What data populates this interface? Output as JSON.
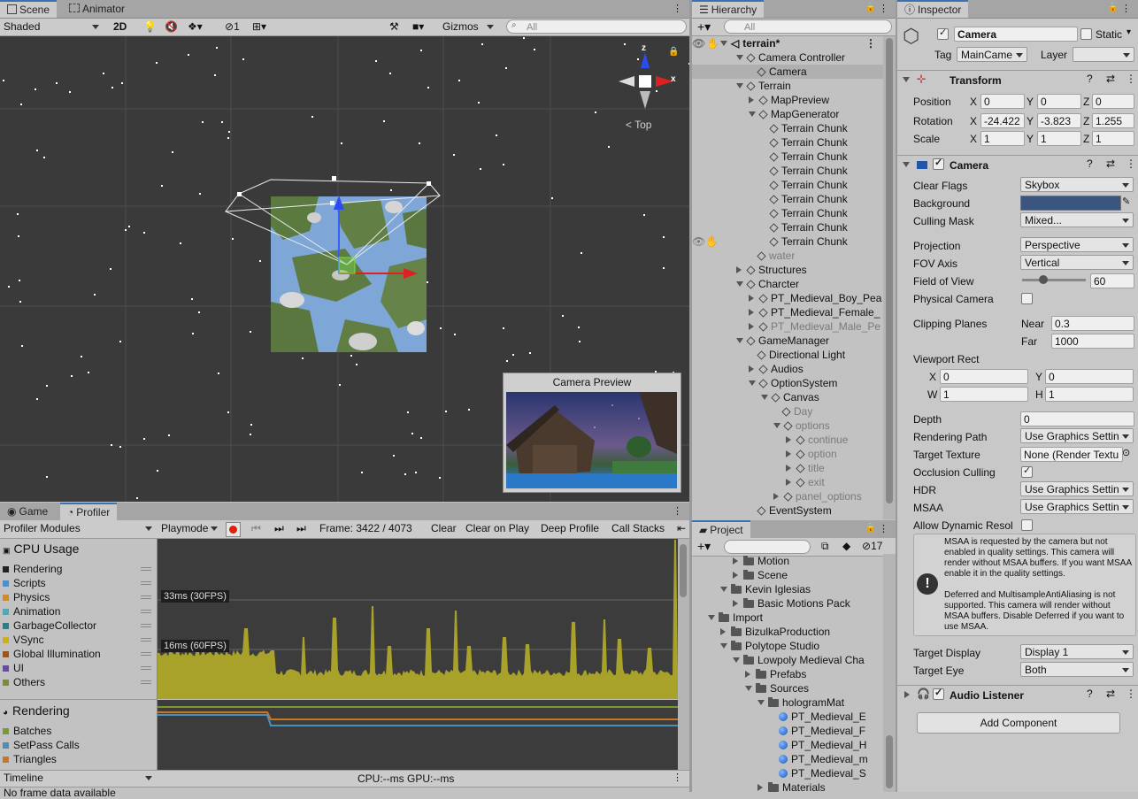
{
  "scene": {
    "tabs": [
      "Scene",
      "Animator"
    ],
    "shading": "Shaded",
    "mode2d": "2D",
    "hidden_count": "1",
    "gizmos": "Gizmos",
    "search_placeholder": "All",
    "view_label": "Top",
    "axis_x": "x",
    "axis_z": "z",
    "camera_preview_title": "Camera Preview"
  },
  "hierarchy": {
    "tab": "Hierarchy",
    "search_placeholder": "All",
    "root": "terrain*",
    "items": [
      {
        "label": "Camera Controller",
        "indent": 1,
        "arrow": "down",
        "icon": "cube",
        "dim": false
      },
      {
        "label": "Camera",
        "indent": 2,
        "arrow": "none",
        "icon": "cube",
        "dim": false,
        "selected": true
      },
      {
        "label": "Terrain",
        "indent": 1,
        "arrow": "down",
        "icon": "cube",
        "dim": false
      },
      {
        "label": "MapPreview",
        "indent": 2,
        "arrow": "right",
        "icon": "cube",
        "dim": false
      },
      {
        "label": "MapGenerator",
        "indent": 2,
        "arrow": "down",
        "icon": "cube",
        "dim": false
      },
      {
        "label": "Terrain Chunk",
        "indent": 3,
        "arrow": "none",
        "icon": "cube",
        "dim": false
      },
      {
        "label": "Terrain Chunk",
        "indent": 3,
        "arrow": "none",
        "icon": "cube",
        "dim": false
      },
      {
        "label": "Terrain Chunk",
        "indent": 3,
        "arrow": "none",
        "icon": "cube",
        "dim": false
      },
      {
        "label": "Terrain Chunk",
        "indent": 3,
        "arrow": "none",
        "icon": "cube",
        "dim": false
      },
      {
        "label": "Terrain Chunk",
        "indent": 3,
        "arrow": "none",
        "icon": "cube",
        "dim": false
      },
      {
        "label": "Terrain Chunk",
        "indent": 3,
        "arrow": "none",
        "icon": "cube",
        "dim": false
      },
      {
        "label": "Terrain Chunk",
        "indent": 3,
        "arrow": "none",
        "icon": "cube",
        "dim": false
      },
      {
        "label": "Terrain Chunk",
        "indent": 3,
        "arrow": "none",
        "icon": "cube",
        "dim": false
      },
      {
        "label": "Terrain Chunk",
        "indent": 3,
        "arrow": "none",
        "icon": "cube",
        "dim": false
      },
      {
        "label": "water",
        "indent": 2,
        "arrow": "none",
        "icon": "cube",
        "dim": true
      },
      {
        "label": "Structures",
        "indent": 1,
        "arrow": "right",
        "icon": "cube",
        "dim": false
      },
      {
        "label": "Charcter",
        "indent": 1,
        "arrow": "down",
        "icon": "cube",
        "dim": false
      },
      {
        "label": "PT_Medieval_Boy_Pea",
        "indent": 2,
        "arrow": "right",
        "icon": "cube",
        "dim": false
      },
      {
        "label": "PT_Medieval_Female_",
        "indent": 2,
        "arrow": "right",
        "icon": "cube",
        "dim": false
      },
      {
        "label": "PT_Medieval_Male_Pe",
        "indent": 2,
        "arrow": "right",
        "icon": "cube",
        "dim": true
      },
      {
        "label": "GameManager",
        "indent": 1,
        "arrow": "down",
        "icon": "cube",
        "dim": false
      },
      {
        "label": "Directional Light",
        "indent": 2,
        "arrow": "none",
        "icon": "cube",
        "dim": false
      },
      {
        "label": "Audios",
        "indent": 2,
        "arrow": "right",
        "icon": "cube",
        "dim": false
      },
      {
        "label": "OptionSystem",
        "indent": 2,
        "arrow": "down",
        "icon": "cube",
        "dim": false
      },
      {
        "label": "Canvas",
        "indent": 3,
        "arrow": "down",
        "icon": "cube",
        "dim": false
      },
      {
        "label": "Day",
        "indent": 4,
        "arrow": "none",
        "icon": "cube",
        "dim": true
      },
      {
        "label": "options",
        "indent": 4,
        "arrow": "down",
        "icon": "cube",
        "dim": true
      },
      {
        "label": "continue",
        "indent": 5,
        "arrow": "right",
        "icon": "cube",
        "dim": true
      },
      {
        "label": "option",
        "indent": 5,
        "arrow": "right",
        "icon": "cube",
        "dim": true
      },
      {
        "label": "title",
        "indent": 5,
        "arrow": "right",
        "icon": "cube",
        "dim": true
      },
      {
        "label": "exit",
        "indent": 5,
        "arrow": "right",
        "icon": "cube",
        "dim": true
      },
      {
        "label": "panel_options",
        "indent": 4,
        "arrow": "right",
        "icon": "cube",
        "dim": true
      },
      {
        "label": "EventSystem",
        "indent": 2,
        "arrow": "none",
        "icon": "cube",
        "dim": false
      }
    ]
  },
  "project": {
    "tab": "Project",
    "hidden_count": "17",
    "items": [
      {
        "label": "Motion",
        "indent": 3,
        "arrow": "right",
        "icon": "folder"
      },
      {
        "label": "Scene",
        "indent": 3,
        "arrow": "right",
        "icon": "folder"
      },
      {
        "label": "Kevin Iglesias",
        "indent": 2,
        "arrow": "down",
        "icon": "folder"
      },
      {
        "label": "Basic Motions Pack",
        "indent": 3,
        "arrow": "right",
        "icon": "folder"
      },
      {
        "label": "Import",
        "indent": 1,
        "arrow": "down",
        "icon": "folder"
      },
      {
        "label": "BizulkaProduction",
        "indent": 2,
        "arrow": "right",
        "icon": "folder"
      },
      {
        "label": "Polytope Studio",
        "indent": 2,
        "arrow": "down",
        "icon": "folder"
      },
      {
        "label": "Lowpoly Medieval Cha",
        "indent": 3,
        "arrow": "down",
        "icon": "folder"
      },
      {
        "label": "Prefabs",
        "indent": 4,
        "arrow": "right",
        "icon": "folder"
      },
      {
        "label": "Sources",
        "indent": 4,
        "arrow": "down",
        "icon": "folder"
      },
      {
        "label": "hologramMat",
        "indent": 5,
        "arrow": "down",
        "icon": "folder"
      },
      {
        "label": "PT_Medieval_E",
        "indent": 6,
        "arrow": "none",
        "icon": "sphere"
      },
      {
        "label": "PT_Medieval_F",
        "indent": 6,
        "arrow": "none",
        "icon": "sphere"
      },
      {
        "label": "PT_Medieval_H",
        "indent": 6,
        "arrow": "none",
        "icon": "sphere"
      },
      {
        "label": "PT_Medieval_m",
        "indent": 6,
        "arrow": "none",
        "icon": "sphere"
      },
      {
        "label": "PT_Medieval_S",
        "indent": 6,
        "arrow": "none",
        "icon": "sphere"
      },
      {
        "label": "Materials",
        "indent": 5,
        "arrow": "right",
        "icon": "folder"
      }
    ]
  },
  "inspector": {
    "tab": "Inspector",
    "object_name": "Camera",
    "static_label": "Static",
    "tag_label": "Tag",
    "tag_value": "MainCame",
    "layer_label": "Layer",
    "layer_value": "",
    "transform": {
      "title": "Transform",
      "position_label": "Position",
      "rotation_label": "Rotation",
      "scale_label": "Scale",
      "position": [
        "0",
        "0",
        "0"
      ],
      "rotation": [
        "-24.422",
        "-3.823",
        "1.255"
      ],
      "scale": [
        "1",
        "1",
        "1"
      ]
    },
    "camera": {
      "title": "Camera",
      "clear_flags_label": "Clear Flags",
      "clear_flags": "Skybox",
      "background_label": "Background",
      "background_color": "#3a5580",
      "culling_mask_label": "Culling Mask",
      "culling_mask": "Mixed...",
      "projection_label": "Projection",
      "projection": "Perspective",
      "fov_axis_label": "FOV Axis",
      "fov_axis": "Vertical",
      "fov_label": "Field of View",
      "fov": "60",
      "fov_fraction": 0.33,
      "physical_label": "Physical Camera",
      "clipping_label": "Clipping Planes",
      "near_label": "Near",
      "near": "0.3",
      "far_label": "Far",
      "far": "1000",
      "viewport_label": "Viewport Rect",
      "vx": "0",
      "vy": "0",
      "vw": "1",
      "vh": "1",
      "depth_label": "Depth",
      "depth": "0",
      "render_path_label": "Rendering Path",
      "render_path": "Use Graphics Settin",
      "target_tex_label": "Target Texture",
      "target_tex": "None (Render Textu",
      "occlusion_label": "Occlusion Culling",
      "hdr_label": "HDR",
      "hdr": "Use Graphics Settin",
      "msaa_label": "MSAA",
      "msaa": "Use Graphics Settin",
      "dyn_res_label": "Allow Dynamic Resol",
      "help_1": "MSAA is requested by the camera but not enabled in quality settings. This camera will render without MSAA buffers. If you want MSAA enable it in the quality settings.",
      "help_2": "Deferred and MultisampleAntiAliasing is not supported. This camera will render without MSAA buffers. Disable Deferred if you want to use MSAA.",
      "target_display_label": "Target Display",
      "target_display": "Display 1",
      "target_eye_label": "Target Eye",
      "target_eye": "Both"
    },
    "audio_listener": "Audio Listener",
    "add_component": "Add Component"
  },
  "profiler": {
    "tabs": [
      "Game",
      "Profiler"
    ],
    "modules_label": "Profiler Modules",
    "playmode": "Playmode",
    "frame": "Frame: 3422 / 4073",
    "clear": "Clear",
    "clear_on_play": "Clear on Play",
    "deep_profile": "Deep Profile",
    "call_stacks": "Call Stacks",
    "cpu_title": "CPU Usage",
    "cpu_items": [
      {
        "label": "Rendering",
        "color": "#222222"
      },
      {
        "label": "Scripts",
        "color": "#4a8fd0"
      },
      {
        "label": "Physics",
        "color": "#d08a2a"
      },
      {
        "label": "Animation",
        "color": "#4fa8b8"
      },
      {
        "label": "GarbageCollector",
        "color": "#2f7d8a"
      },
      {
        "label": "VSync",
        "color": "#c8b020"
      },
      {
        "label": "Global Illumination",
        "color": "#a0541a"
      },
      {
        "label": "UI",
        "color": "#6a4aa0"
      },
      {
        "label": "Others",
        "color": "#7a8a40"
      }
    ],
    "rendering_title": "Rendering",
    "render_items": [
      {
        "label": "Batches",
        "color": "#7a9a30"
      },
      {
        "label": "SetPass Calls",
        "color": "#4a8fb8"
      },
      {
        "label": "Triangles",
        "color": "#c87820"
      }
    ],
    "line_33": "33ms (30FPS)",
    "line_16": "16ms (60FPS)",
    "timeline": "Timeline",
    "cpu_gpu": "CPU:--ms  GPU:--ms",
    "status": "No frame data available"
  }
}
